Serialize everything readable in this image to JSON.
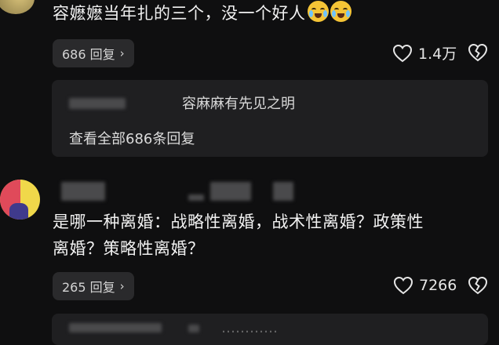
{
  "comment1": {
    "text": "容嬷嬷当年扎的三个，没一个好人",
    "emojis": [
      "crying-laughing-emoji",
      "crying-laughing-emoji"
    ],
    "reply_button": "686 回复",
    "likes": "1.4万"
  },
  "sub_reply": {
    "quote": "容麻麻有先见之明",
    "view_all": "查看全部686条回复"
  },
  "comment2": {
    "text_line1": "是哪一种离婚：战略性离婚，战术性离婚？政策性",
    "text_line2": "离婚？策略性离婚？",
    "reply_button": "265 回复",
    "likes": "7266"
  },
  "sub_reply2": {
    "partial_text": "…………"
  },
  "icons": {
    "like": "heart-outline-icon",
    "dislike": "broken-heart-icon",
    "chevron": "chevron-right-icon"
  },
  "colors": {
    "background": "#0f0f10",
    "reply_bg": "#2a2a2c",
    "sub_box_bg": "#1f1f21"
  }
}
